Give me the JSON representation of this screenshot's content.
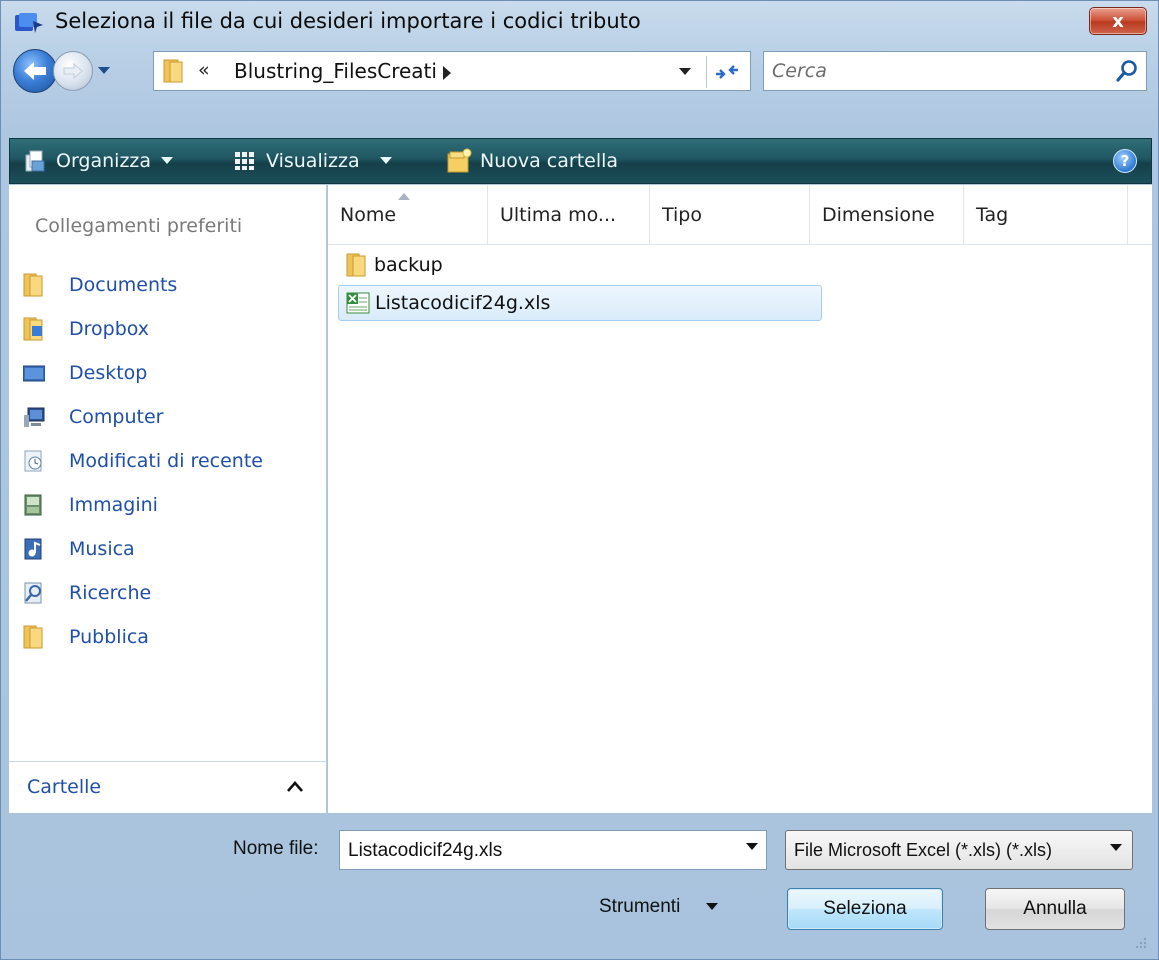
{
  "window": {
    "title": "Seleziona il file da cui desideri importare i codici tributo",
    "close_label": "x"
  },
  "address": {
    "overflow": "«",
    "crumb": "Blustring_FilesCreati"
  },
  "search": {
    "placeholder": "Cerca"
  },
  "toolbar": {
    "organize": "Organizza",
    "view": "Visualizza",
    "new_folder": "Nuova cartella",
    "help": "?"
  },
  "nav": {
    "header": "Collegamenti preferiti",
    "items": [
      {
        "label": "Documents",
        "icon": "folder-icon"
      },
      {
        "label": "Dropbox",
        "icon": "dropbox-folder-icon"
      },
      {
        "label": "Desktop",
        "icon": "desktop-icon"
      },
      {
        "label": "Computer",
        "icon": "computer-icon"
      },
      {
        "label": "Modificati di recente",
        "icon": "recent-icon"
      },
      {
        "label": "Immagini",
        "icon": "pictures-icon"
      },
      {
        "label": "Musica",
        "icon": "music-icon"
      },
      {
        "label": "Ricerche",
        "icon": "searches-icon"
      },
      {
        "label": "Pubblica",
        "icon": "folder-icon"
      }
    ],
    "folders_label": "Cartelle"
  },
  "columns": [
    "Nome",
    "Ultima mo...",
    "Tipo",
    "Dimensione",
    "Tag"
  ],
  "files": [
    {
      "name": "backup",
      "icon": "folder-icon"
    },
    {
      "name": "Listacodicif24g.xls",
      "icon": "excel-file-icon"
    }
  ],
  "bottom": {
    "filename_label": "Nome file:",
    "filename_value": "Listacodicif24g.xls",
    "filetype": "File Microsoft Excel (*.xls) (*.xls)",
    "tools": "Strumenti",
    "select": "Seleziona",
    "cancel": "Annulla"
  }
}
